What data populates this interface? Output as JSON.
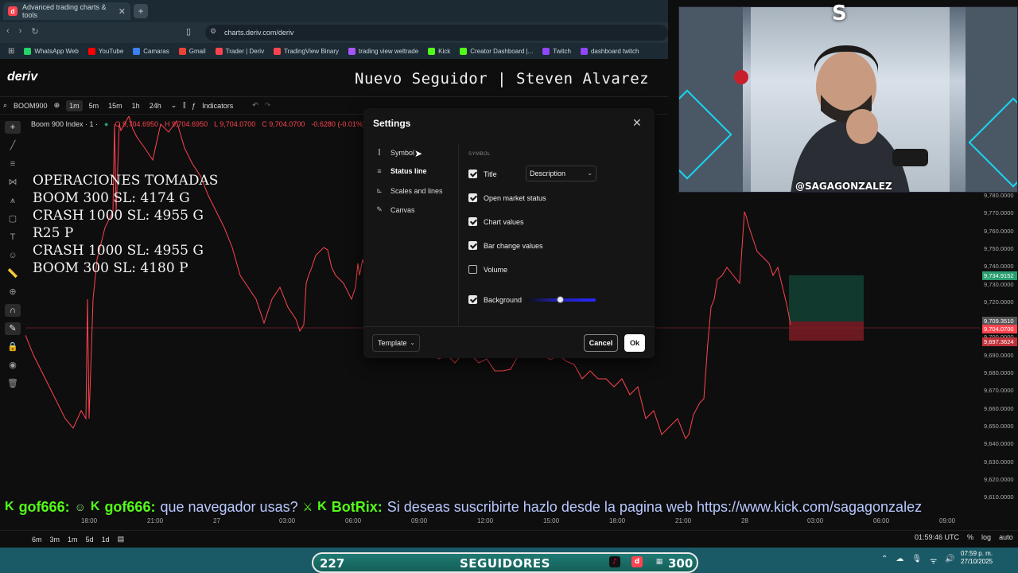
{
  "browser": {
    "tab_title": "Advanced trading charts & tools",
    "url": "charts.deriv.com/deriv",
    "bookmarks": [
      {
        "label": "WhatsApp Web",
        "color": "#25d366"
      },
      {
        "label": "YouTube",
        "color": "#ff0000"
      },
      {
        "label": "Camaras",
        "color": "#3b82f6"
      },
      {
        "label": "Gmail",
        "color": "#ea4335"
      },
      {
        "label": "Trader | Deriv",
        "color": "#ff444f"
      },
      {
        "label": "TradingView Binary",
        "color": "#ff444f"
      },
      {
        "label": "trading view weltrade",
        "color": "#a855f7"
      },
      {
        "label": "Kick",
        "color": "#53fc18"
      },
      {
        "label": "Creator Dashboard |...",
        "color": "#53fc18"
      },
      {
        "label": "Twitch",
        "color": "#9146ff"
      },
      {
        "label": "dashboard twitch",
        "color": "#9146ff"
      }
    ]
  },
  "app": {
    "logo": "deriv",
    "overlay_title": "Nuevo Seguidor | Steven Alvarez"
  },
  "toolbar": {
    "symbol": "BOOM900",
    "timeframes": [
      "1m",
      "5m",
      "15m",
      "1h",
      "24h"
    ],
    "active_timeframe": "1m",
    "indicators_label": "Indicators"
  },
  "chart": {
    "symbol_line": "Boom 900 Index · 1 ·",
    "ohlc": {
      "o": "O 9,704.6950",
      "h": "H 9,704.6950",
      "l": "L 9,704.0700",
      "c": "C 9,704.0700",
      "change": "-0.6280 (-0.01%)"
    },
    "operations": [
      "OPERACIONES TOMADAS",
      "BOOM 300 SL: 4174 G",
      "CRASH 1000 SL: 4955 G",
      "R25 P",
      "CRASH 1000 SL: 4955 G",
      "BOOM 300 SL: 4180 P"
    ],
    "y_ticks": [
      "9,780.0000",
      "9,770.0000",
      "9,760.0000",
      "9,750.0000",
      "9,740.0000",
      "9,730.0000",
      "9,720.0000",
      "9,710.0000",
      "9,700.0000",
      "9,690.0000",
      "9,680.0000",
      "9,670.0000",
      "9,660.0000",
      "9,650.0000",
      "9,640.0000",
      "9,630.0000",
      "9,620.0000",
      "9,610.0000"
    ],
    "price_labels": [
      {
        "text": "9,734.9152",
        "color": "#2a9d6f"
      },
      {
        "text": "9,709.3510",
        "color": "#555555"
      },
      {
        "text": "9,704.0700",
        "color": "#ff444f"
      },
      {
        "text": "9,697.3624",
        "color": "#c0323b"
      }
    ],
    "x_ticks": [
      "18:00",
      "21:00",
      "27",
      "03:00",
      "06:00",
      "09:00",
      "12:00",
      "15:00",
      "18:00",
      "21:00",
      "28",
      "03:00",
      "06:00",
      "09:00"
    ],
    "bottom_periods": [
      "6m",
      "3m",
      "1m",
      "5d",
      "1d"
    ],
    "time": "01:59:46 UTC",
    "scale_options": [
      "%",
      "log",
      "auto"
    ]
  },
  "dialog": {
    "title": "Settings",
    "nav": [
      {
        "label": "Symbol",
        "icon": "candles-icon"
      },
      {
        "label": "Status line",
        "icon": "lines-icon"
      },
      {
        "label": "Scales and lines",
        "icon": "scales-icon"
      },
      {
        "label": "Canvas",
        "icon": "pencil-icon"
      }
    ],
    "active_nav": "Status line",
    "section": "SYMBOL",
    "options": [
      {
        "label": "Title",
        "checked": true
      },
      {
        "label": "Open market status",
        "checked": true
      },
      {
        "label": "Chart values",
        "checked": true
      },
      {
        "label": "Bar change values",
        "checked": true
      },
      {
        "label": "Volume",
        "checked": false
      },
      {
        "label": "Background",
        "checked": true
      }
    ],
    "title_select": "Description",
    "template_label": "Template",
    "cancel_label": "Cancel",
    "ok_label": "Ok"
  },
  "stream": {
    "webcam_handle": "@SAGAGONZALEZ",
    "ticker": {
      "user1": "gof666:",
      "user2": "gof666:",
      "msg1": "que navegador usas?",
      "user3": "BotRix:",
      "msg2": "Si deseas suscribirte hazlo desde la pagina web https://www.kick.com/sagagonzalez"
    },
    "followers": {
      "count": "227",
      "label": "SEGUIDORES",
      "goal": "300"
    }
  },
  "taskbar": {
    "time": "07:59 p. m.",
    "date": "27/10/2025"
  }
}
